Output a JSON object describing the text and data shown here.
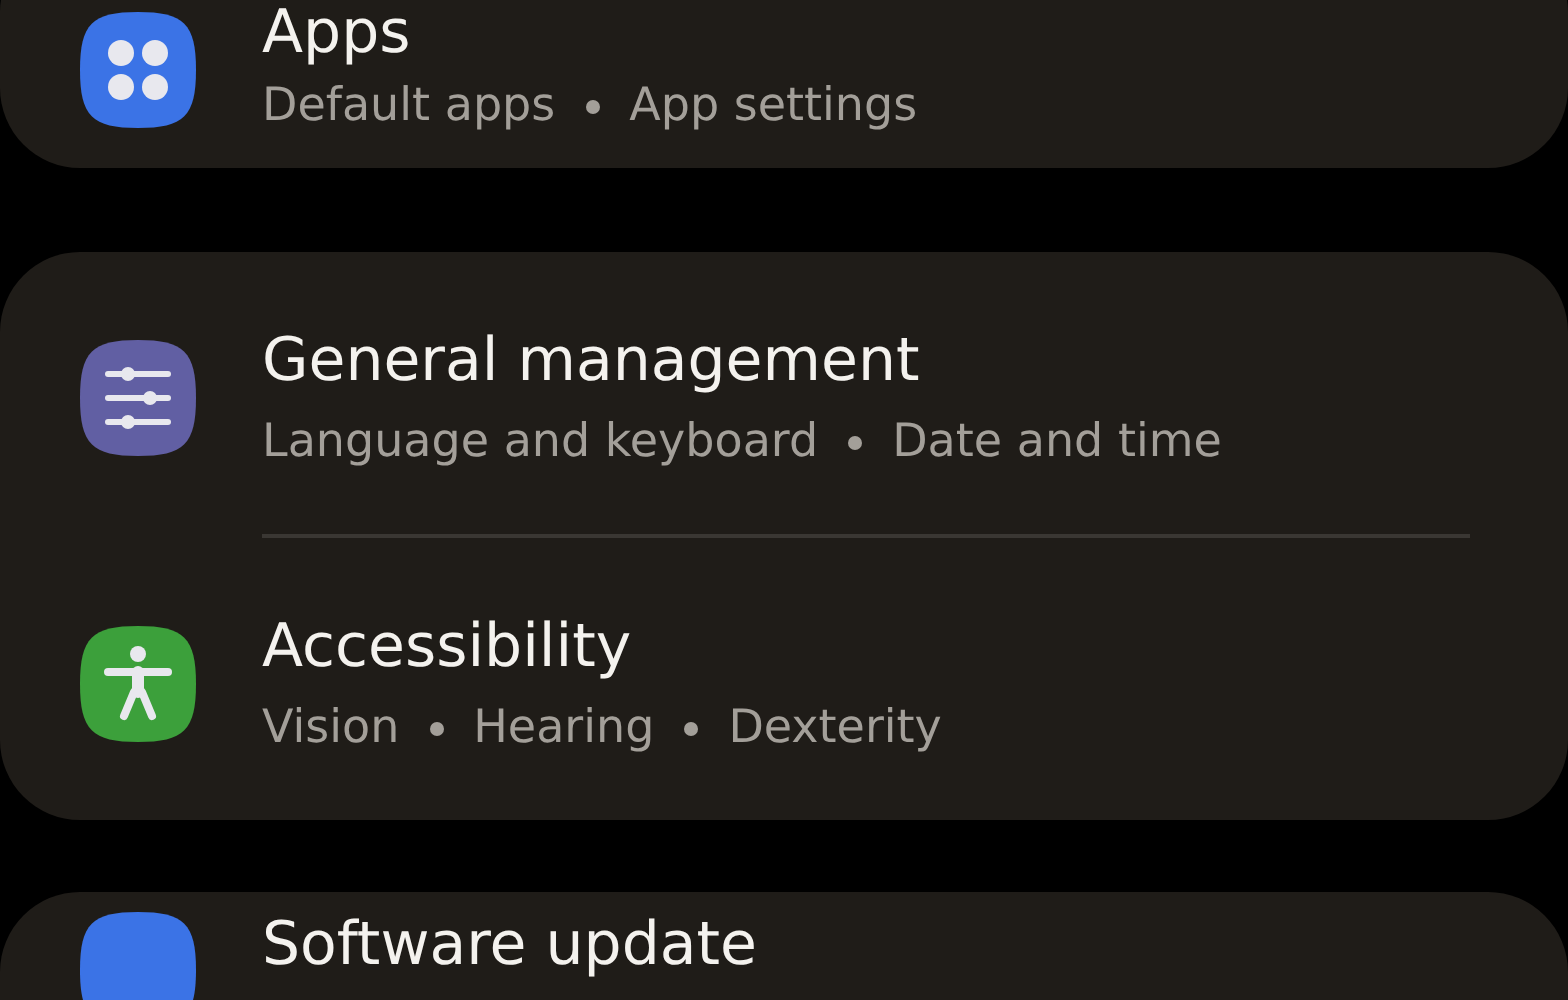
{
  "cards": [
    {
      "items": [
        {
          "kind": "apps",
          "title": "Apps",
          "subtitles": [
            "Default apps",
            "App settings"
          ]
        }
      ]
    },
    {
      "items": [
        {
          "kind": "sliders",
          "title": "General management",
          "subtitles": [
            "Language and keyboard",
            "Date and time"
          ]
        },
        {
          "kind": "accessibility",
          "title": "Accessibility",
          "subtitles": [
            "Vision",
            "Hearing",
            "Dexterity"
          ]
        }
      ]
    },
    {
      "items": [
        {
          "kind": "update",
          "title": "Software update"
        }
      ]
    }
  ]
}
